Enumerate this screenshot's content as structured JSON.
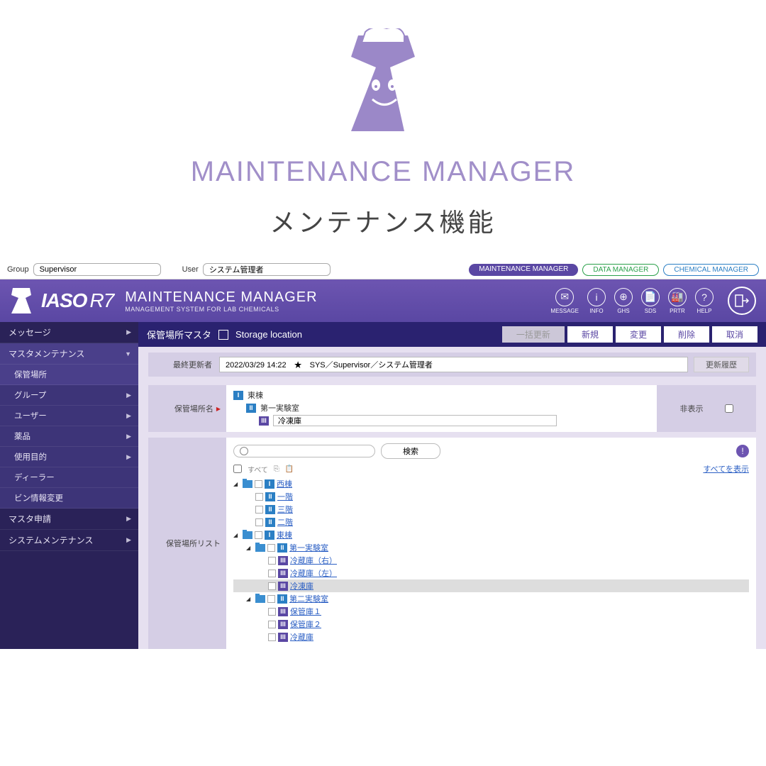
{
  "promo": {
    "title": "MAINTENANCE MANAGER",
    "subtitle": "メンテナンス機能"
  },
  "topbar": {
    "group_label": "Group",
    "group_value": "Supervisor",
    "user_label": "User",
    "user_value": "システム管理者",
    "pills": {
      "maintenance": "MAINTENANCE MANAGER",
      "data": "DATA MANAGER",
      "chemical": "CHEMICAL MANAGER"
    }
  },
  "banner": {
    "brand": "IASO",
    "brand_suffix": "R7",
    "title": "MAINTENANCE MANAGER",
    "subtitle": "MANAGEMENT SYSTEM FOR LAB CHEMICALS",
    "icons": [
      {
        "label": "MESSAGE",
        "glyph": "✉"
      },
      {
        "label": "INFO",
        "glyph": "i"
      },
      {
        "label": "GHS",
        "glyph": "⊕"
      },
      {
        "label": "SDS",
        "glyph": "📄"
      },
      {
        "label": "PRTR",
        "glyph": "🏭"
      },
      {
        "label": "HELP",
        "glyph": "?"
      }
    ]
  },
  "sidebar": [
    {
      "label": "メッセージ",
      "arrow": "▶"
    },
    {
      "label": "マスタメンテナンス",
      "arrow": "▼",
      "expanded": true,
      "children": [
        {
          "label": "保管場所",
          "active": true
        },
        {
          "label": "グループ",
          "arrow": "▶"
        },
        {
          "label": "ユーザー",
          "arrow": "▶"
        },
        {
          "label": "薬品",
          "arrow": "▶"
        },
        {
          "label": "使用目的",
          "arrow": "▶"
        },
        {
          "label": "ディーラー"
        },
        {
          "label": "ビン情報変更"
        }
      ]
    },
    {
      "label": "マスタ申請",
      "arrow": "▶"
    },
    {
      "label": "システムメンテナンス",
      "arrow": "▶"
    }
  ],
  "page": {
    "title_jp": "保管場所マスタ",
    "title_en": "Storage location",
    "actions": {
      "bulk": "一括更新",
      "new": "新規",
      "edit": "変更",
      "delete": "削除",
      "cancel": "取消"
    },
    "last_update_label": "最終更新者",
    "last_update_value": "2022/03/29 14:22　★　SYS／Supervisor／システム管理者",
    "history_btn": "更新履歴",
    "loc_name_label": "保管場所名",
    "loc_hierarchy": {
      "l1": "東棟",
      "l2": "第一実験室",
      "l3": "冷凍庫"
    },
    "hidden_label": "非表示",
    "list_label": "保管場所リスト",
    "search_btn": "検索",
    "toolbar_all": "すべて",
    "show_all_link": "すべてを表示",
    "tree": [
      {
        "indent": 0,
        "tri": "◢",
        "folder": true,
        "lvl": "I",
        "lvlcls": "lvl1",
        "label": "西棟"
      },
      {
        "indent": 1,
        "lvl": "II",
        "lvlcls": "lvl2",
        "label": "一階"
      },
      {
        "indent": 1,
        "lvl": "II",
        "lvlcls": "lvl2",
        "label": "三階"
      },
      {
        "indent": 1,
        "lvl": "II",
        "lvlcls": "lvl2",
        "label": "二階"
      },
      {
        "indent": 0,
        "tri": "◢",
        "folder": true,
        "lvl": "I",
        "lvlcls": "lvl1",
        "label": "東棟"
      },
      {
        "indent": 1,
        "tri": "◢",
        "folder": true,
        "lvl": "II",
        "lvlcls": "lvl2",
        "label": "第一実験室"
      },
      {
        "indent": 2,
        "lvl": "III",
        "lvlcls": "lvl3",
        "label": "冷蔵庫（右）"
      },
      {
        "indent": 2,
        "lvl": "III",
        "lvlcls": "lvl3",
        "label": "冷蔵庫（左）"
      },
      {
        "indent": 2,
        "lvl": "III",
        "lvlcls": "lvl3",
        "label": "冷凍庫",
        "selected": true
      },
      {
        "indent": 1,
        "tri": "◢",
        "folder": true,
        "lvl": "II",
        "lvlcls": "lvl2",
        "label": "第二実験室"
      },
      {
        "indent": 2,
        "lvl": "III",
        "lvlcls": "lvl3",
        "label": "保管庫１"
      },
      {
        "indent": 2,
        "lvl": "III",
        "lvlcls": "lvl3",
        "label": "保管庫２"
      },
      {
        "indent": 2,
        "lvl": "III",
        "lvlcls": "lvl3",
        "label": "冷蔵庫"
      }
    ]
  }
}
